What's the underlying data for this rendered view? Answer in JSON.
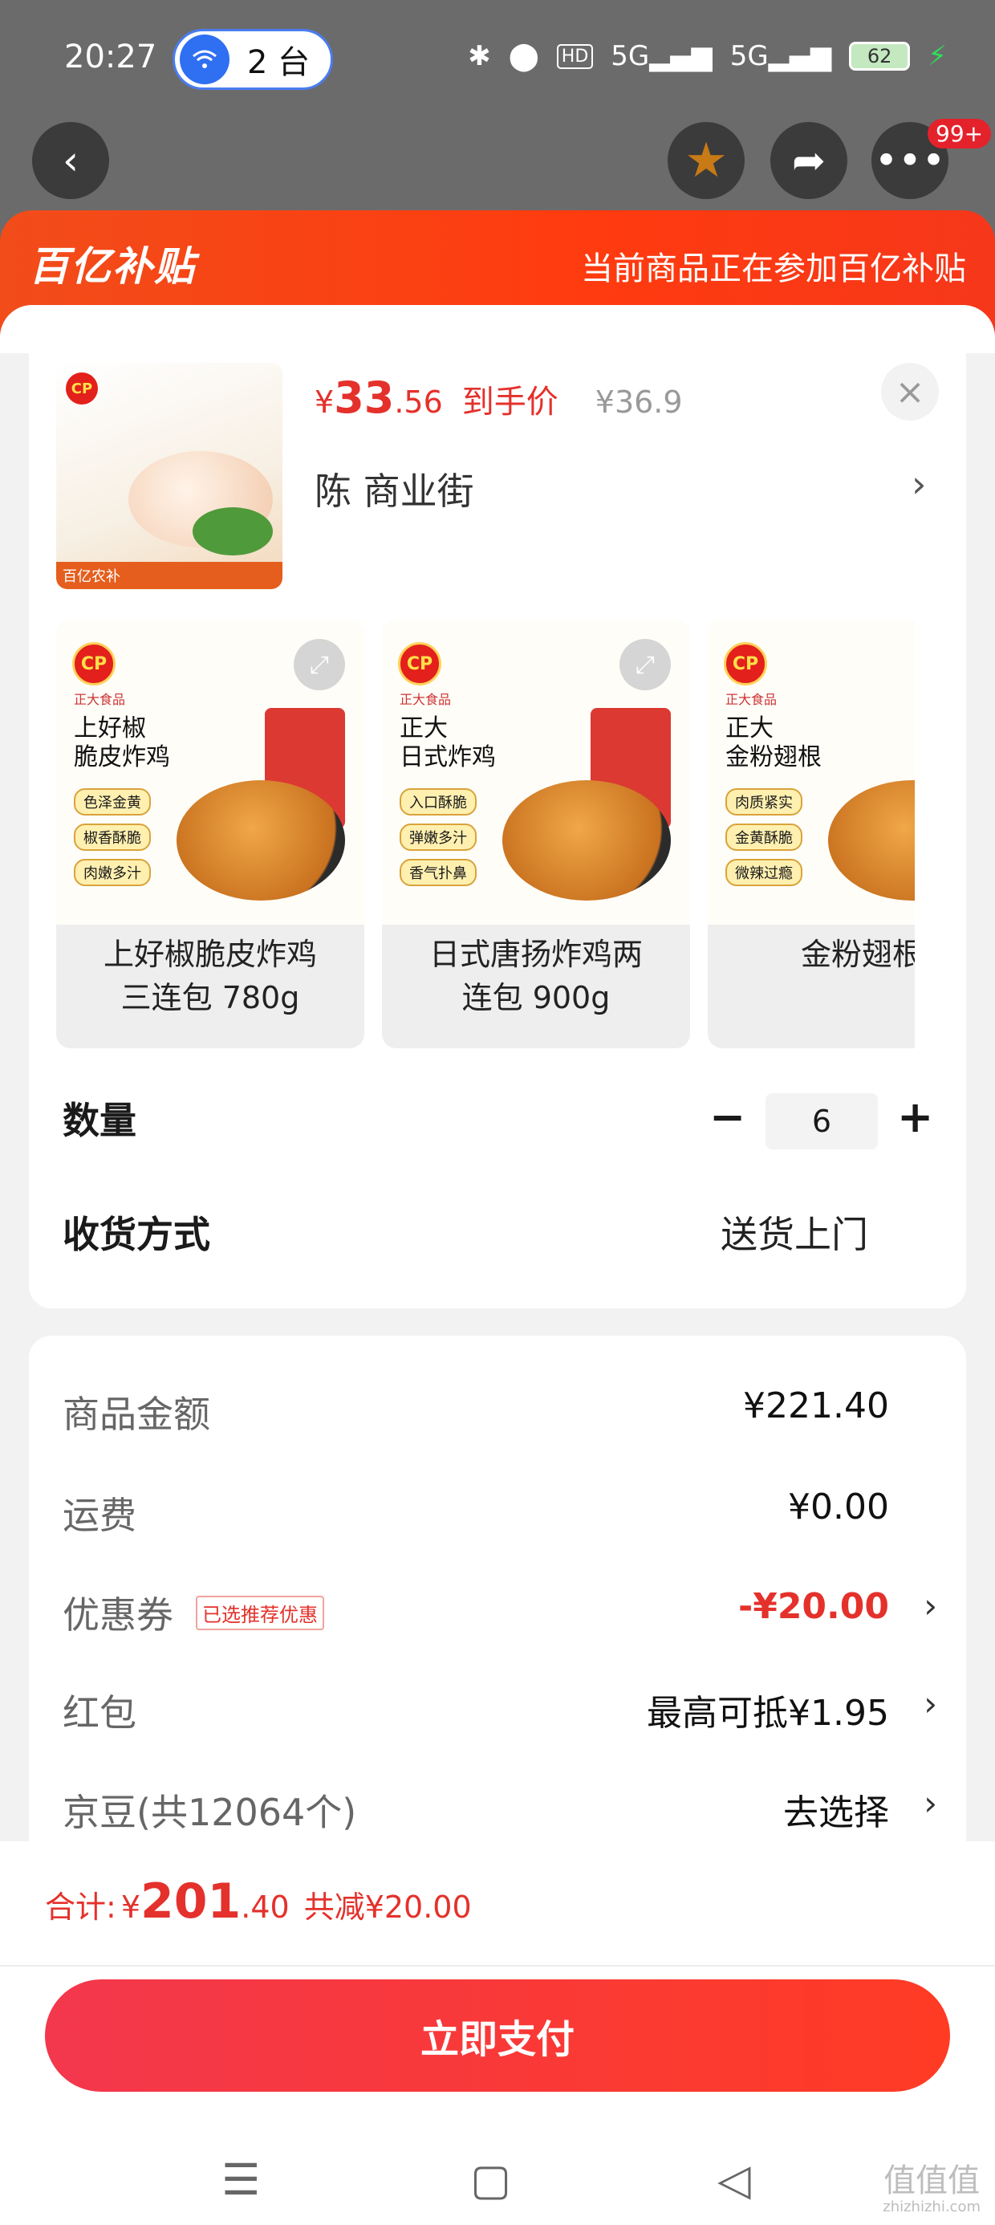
{
  "status_bar": {
    "time": "20:27",
    "cast_count": "2 台",
    "battery": "62",
    "icons": [
      "bluetooth-icon",
      "location-icon",
      "hd-icon",
      "signal-5g-icon",
      "signal-5g-icon",
      "battery-icon"
    ]
  },
  "header": {
    "badge": "99+"
  },
  "banner": {
    "logo": "百亿补贴",
    "text": "当前商品正在参加百亿补贴"
  },
  "product": {
    "price_yen": "¥",
    "price_int": "33",
    "price_dec": ".56",
    "price_label": "到手价",
    "price_orig": "¥36.9",
    "address": "陈  商业街",
    "thumb_strip": "百亿农补"
  },
  "variants": [
    {
      "brand": "正大食品",
      "title": "上好椒\n脆皮炸鸡",
      "tags": [
        "色泽金黄",
        "椒香酥脆",
        "肉嫩多汁"
      ],
      "name": "上好椒脆皮炸鸡\n三连包 780g"
    },
    {
      "brand": "正大食品",
      "title": "正大\n日式炸鸡",
      "tags": [
        "入口酥脆",
        "弹嫩多汁",
        "香气扑鼻"
      ],
      "name": "日式唐扬炸鸡两\n连包 900g"
    },
    {
      "brand": "正大食品",
      "title": "正大\n金粉翅根",
      "tags": [
        "肉质紧实",
        "金黄酥脆",
        "微辣过瘾"
      ],
      "name": "金粉翅根"
    }
  ],
  "quantity": {
    "label": "数量",
    "value": "6"
  },
  "shipping": {
    "label": "收货方式",
    "value": "送货上门"
  },
  "fees": {
    "goods_label": "商品金额",
    "goods_value": "¥221.40",
    "freight_label": "运费",
    "freight_value": "¥0.00",
    "coupon_label": "优惠券",
    "coupon_tag": "已选推荐优惠",
    "coupon_value": "-¥20.00",
    "redpack_label": "红包",
    "redpack_value": "最高可抵¥1.95",
    "jingdou_label": "京豆(共12064个)",
    "jingdou_value": "去选择"
  },
  "footer": {
    "total_label": "合计:",
    "total_yen": "¥",
    "total_int": "201",
    "total_dec": ".40",
    "total_save": "共减¥20.00",
    "pay_label": "立即支付"
  },
  "watermark": {
    "text": "值值值",
    "small": "zhizhizhi.com"
  },
  "colors": {
    "accent": "#e4312b",
    "banner": "#ff3b0f"
  }
}
